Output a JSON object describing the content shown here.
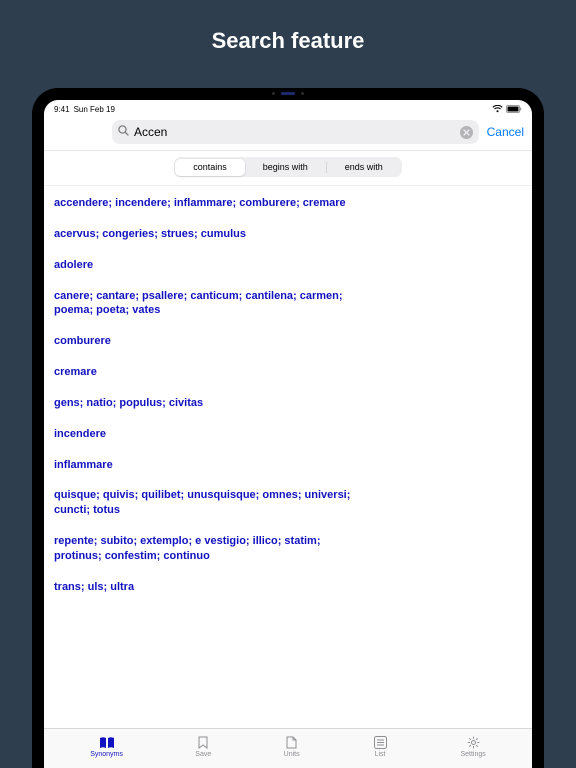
{
  "page": {
    "title": "Search feature"
  },
  "status": {
    "time": "9:41",
    "date": "Sun Feb 19"
  },
  "search": {
    "query": "Accen",
    "cancel": "Cancel"
  },
  "segments": {
    "contains": "contains",
    "begins": "begins with",
    "ends": "ends with",
    "selected": "contains"
  },
  "results": [
    "accendere; incendere; inflammare; comburere; cremare",
    "acervus; congeries; strues; cumulus",
    "adolere",
    "canere; cantare; psallere; canticum; cantilena; carmen; poema; poeta; vates",
    "comburere",
    "cremare",
    "gens; natio; populus; civitas",
    "incendere",
    "inflammare",
    "quisque; quivis; quilibet; unusquisque; omnes; universi; cuncti; totus",
    "repente; subito; extemplo; e vestigio; illico; statim; protinus; confestim; continuo",
    "trans; uls; ultra"
  ],
  "tabs": {
    "synonyms": "Synonyms",
    "save": "Save",
    "units": "Units",
    "list": "List",
    "settings": "Settings"
  }
}
